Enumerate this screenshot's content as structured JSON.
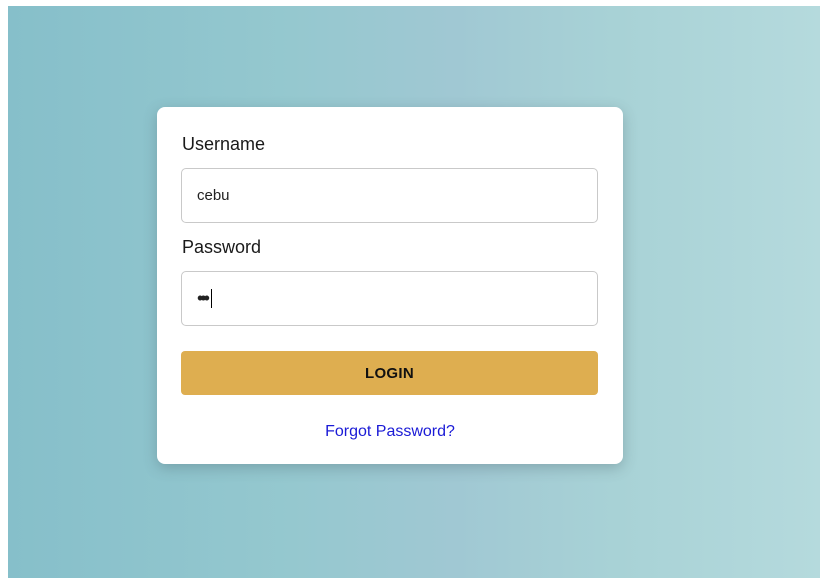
{
  "login_form": {
    "username_label": "Username",
    "username_value": "cebu",
    "password_label": "Password",
    "password_masked": "•••",
    "login_button_label": "LOGIN",
    "forgot_password_link": "Forgot Password?"
  },
  "colors": {
    "button_background": "#deae50",
    "link": "#1a1ad6",
    "background_gradient_start": "#86bfca",
    "background_gradient_end": "#b5dadd"
  }
}
